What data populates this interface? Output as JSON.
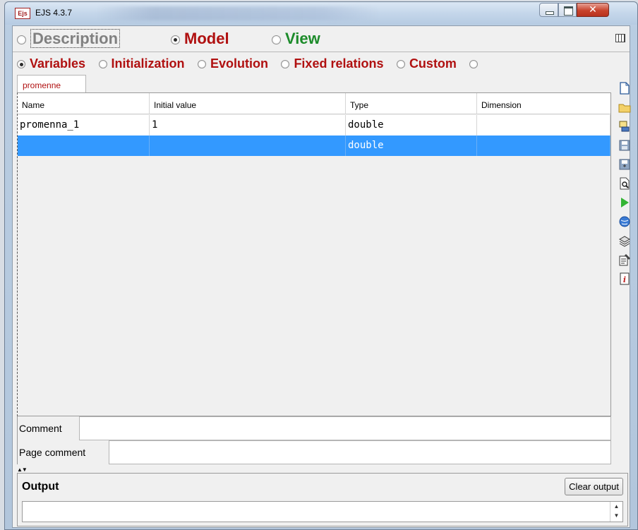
{
  "window": {
    "title": "EJS 4.3.7",
    "icon_text": "Ejs"
  },
  "top_tabs": [
    {
      "label": "Description",
      "selected": false
    },
    {
      "label": "Model",
      "selected": true
    },
    {
      "label": "View",
      "selected": false
    }
  ],
  "sub_tabs": [
    {
      "label": "Variables",
      "selected": true
    },
    {
      "label": "Initialization",
      "selected": false
    },
    {
      "label": "Evolution",
      "selected": false
    },
    {
      "label": "Fixed relations",
      "selected": false
    },
    {
      "label": "Custom",
      "selected": false
    }
  ],
  "page_tab": "promenne",
  "table": {
    "headers": [
      "Name",
      "Initial value",
      "Type",
      "Dimension"
    ],
    "rows": [
      {
        "name": "promenna_1",
        "initial": "1",
        "type": "double",
        "dimension": ""
      },
      {
        "name": "",
        "initial": "",
        "type": "double",
        "dimension": ""
      }
    ]
  },
  "comment_label": "Comment",
  "page_comment_label": "Page comment",
  "output": {
    "title": "Output",
    "clear_label": "Clear output"
  },
  "toolbar_icons": [
    "new-file-icon",
    "open-folder-icon",
    "network-icon",
    "save-icon",
    "save-as-icon",
    "preview-icon",
    "run-icon",
    "web-icon",
    "layers-icon",
    "properties-icon",
    "info-icon"
  ],
  "colors": {
    "section_red": "#b01010",
    "view_green": "#1c8b2a",
    "selection_blue": "#3399ff"
  }
}
